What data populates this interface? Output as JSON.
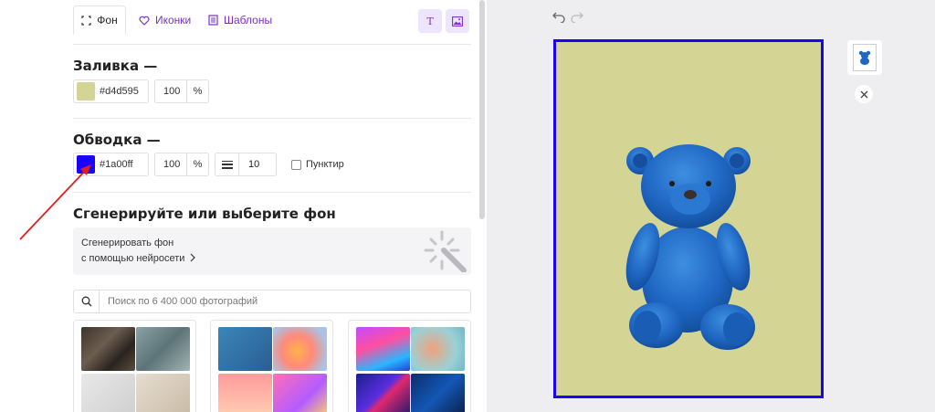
{
  "tabs": {
    "background": "Фон",
    "icons": "Иконки",
    "templates": "Шаблоны",
    "text_tool_icon": "text-icon",
    "image_tool_icon": "image-icon"
  },
  "fill": {
    "title": "Заливка —",
    "color_hex": "#d4d595",
    "color_label": "#d4d595",
    "opacity": "100",
    "unit": "%"
  },
  "stroke": {
    "title": "Обводка —",
    "color_hex": "#1a00ff",
    "color_label": "#1a00ff",
    "opacity": "100",
    "unit": "%",
    "width": "10",
    "dashed_label": "Пунктир"
  },
  "generate": {
    "title": "Сгенерируйте или выберите фон",
    "card_line1": "Сгенерировать фон",
    "card_line2": "с помощью нейросети"
  },
  "search": {
    "placeholder": "Поиск по 6 400 000 фотографий"
  },
  "canvas": {
    "background": "#d4d595",
    "border": "#1a00ff"
  },
  "colors": {
    "accent": "#7b2fd1",
    "annotation_arrow": "#e01e1e"
  }
}
